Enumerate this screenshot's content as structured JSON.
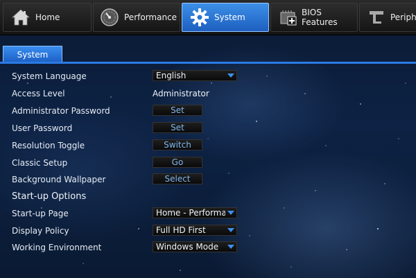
{
  "tabs": [
    {
      "label": "Home",
      "icon": "home-icon",
      "active": false
    },
    {
      "label": "Performance",
      "icon": "gauge-icon",
      "active": false
    },
    {
      "label": "System",
      "icon": "gear-icon",
      "active": true
    },
    {
      "label_line1": "BIOS",
      "label_line2": "Features",
      "icon": "bios-features-icon",
      "active": false
    },
    {
      "label": "Peripheral",
      "icon": "peripherals-icon",
      "active": false
    }
  ],
  "subtab": {
    "label": "System"
  },
  "settings": {
    "system_language": {
      "label": "System Language",
      "value": "English"
    },
    "access_level": {
      "label": "Access Level",
      "value": "Administrator"
    },
    "admin_password": {
      "label": "Administrator Password",
      "button": "Set"
    },
    "user_password": {
      "label": "User Password",
      "button": "Set"
    },
    "resolution_toggle": {
      "label": "Resolution Toggle",
      "button": "Switch"
    },
    "classic_setup": {
      "label": "Classic Setup",
      "button": "Go"
    },
    "background_wallpaper": {
      "label": "Background Wallpaper",
      "button": "Select"
    }
  },
  "startup": {
    "section_title": "Start-up Options",
    "startup_page": {
      "label": "Start-up Page",
      "value": "Home - Performance"
    },
    "display_policy": {
      "label": "Display Policy",
      "value": "Full HD First"
    },
    "working_environment": {
      "label": "Working Environment",
      "value": "Windows Mode"
    }
  },
  "colors": {
    "accent_blue": "#2a7be4",
    "button_text": "#7fb7f0"
  }
}
